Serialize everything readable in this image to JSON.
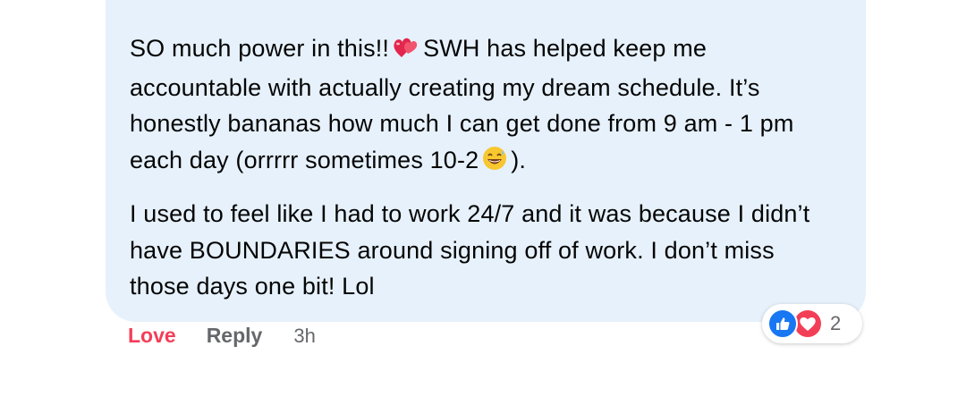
{
  "comment": {
    "paragraphs": [
      {
        "before_emoji": "SO much power in this!!",
        "emoji_name": "two-hearts-icon",
        "after_emoji": "SWH has helped keep me accountable with actually creating my dream schedule. It’s honestly bananas how much I can get done from 9 am - 1 pm each day (orrrrr sometimes 10-2",
        "emoji2_name": "grinning-sweat-face-icon",
        "end": ")."
      },
      {
        "text": "I used to feel like I had to work 24/7 and it was because I didn’t have BOUNDARIES around signing off of work. I don’t miss those days one bit! Lol"
      }
    ]
  },
  "reactions": {
    "icons": [
      "like-icon",
      "love-heart-icon"
    ],
    "count": "2"
  },
  "actions": {
    "love_label": "Love",
    "reply_label": "Reply",
    "timestamp": "3h"
  },
  "colors": {
    "bubble": "#e6f1fb",
    "love": "#f33e58",
    "like": "#1877f2",
    "muted": "#65676b"
  }
}
